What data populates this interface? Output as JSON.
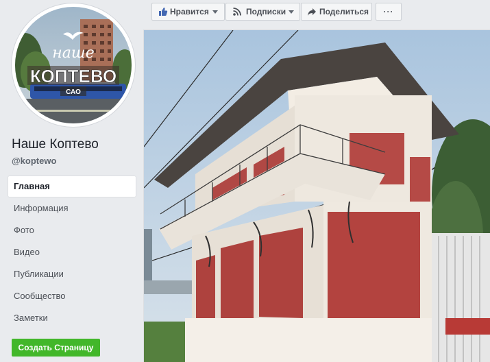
{
  "page": {
    "name": "Наше Коптево",
    "handle": "@koptewo"
  },
  "avatar_logo": {
    "line1": "наше",
    "line2": "КОПТЕВО",
    "line3": "САО"
  },
  "nav": {
    "items": [
      {
        "label": "Главная",
        "active": true
      },
      {
        "label": "Информация",
        "active": false
      },
      {
        "label": "Фото",
        "active": false
      },
      {
        "label": "Видео",
        "active": false
      },
      {
        "label": "Публикации",
        "active": false
      },
      {
        "label": "Сообщество",
        "active": false
      },
      {
        "label": "Заметки",
        "active": false
      }
    ]
  },
  "create_page_label": "Создать Страницу",
  "toolbar": {
    "like_label": "Нравится",
    "follow_label": "Подписки",
    "share_label": "Поделиться",
    "more_label": "···"
  },
  "icons": {
    "like": "thumbs-up-icon",
    "follow": "rss-icon",
    "share": "share-arrow-icon"
  },
  "colors": {
    "accent_blue": "#4267b2",
    "create_green": "#42b72a",
    "background": "#e9ebee"
  }
}
